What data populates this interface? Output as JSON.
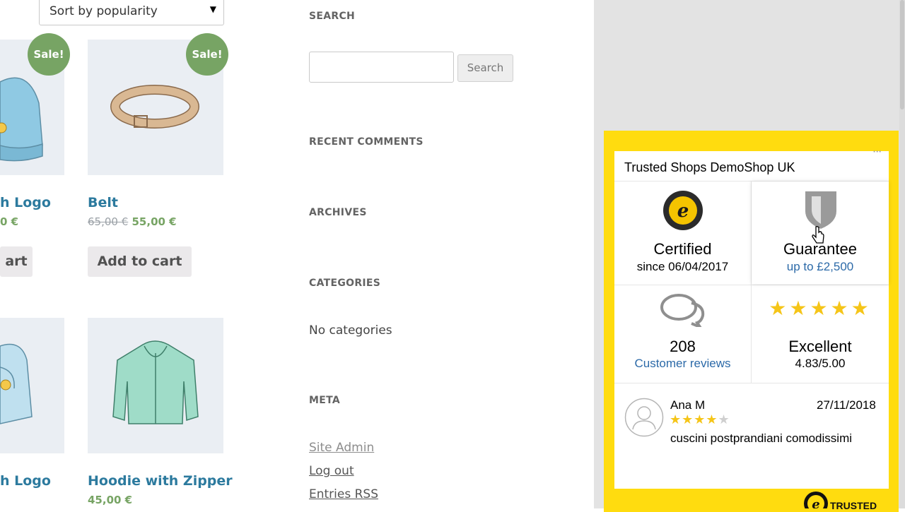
{
  "shop": {
    "sort_select": {
      "value": "Sort by popularity"
    },
    "products": [
      {
        "name": "h Logo",
        "price": "0 €",
        "sale": "Sale!",
        "cart": "art"
      },
      {
        "name": "Belt",
        "old_price": "65,00 €",
        "price": "55,00 €",
        "sale": "Sale!",
        "cart": "Add to cart"
      },
      {
        "name": "h Logo"
      },
      {
        "name": "Hoodie with Zipper",
        "price": "45,00 €"
      }
    ]
  },
  "sidebar": {
    "search_title": "SEARCH",
    "search_placeholder": "",
    "search_button": "Search",
    "recent_comments_title": "RECENT COMMENTS",
    "archives_title": "ARCHIVES",
    "categories_title": "CATEGORIES",
    "no_categories": "No categories",
    "meta_title": "META",
    "meta_links": [
      "Site Admin",
      "Log out",
      "Entries RSS"
    ]
  },
  "trustbadge": {
    "shop_name": "Trusted Shops DemoShop UK",
    "menu_dots": "···",
    "certified_title": "Certified",
    "certified_since": "since 06/04/2017",
    "guarantee_title": "Guarantee",
    "guarantee_amount": "up to £2,500",
    "reviews_count": "208",
    "reviews_label": "Customer reviews",
    "rating_label": "Excellent",
    "rating_value": "4.83/5.00",
    "rating_stars": "★★★★★",
    "review": {
      "author": "Ana M",
      "date": "27/11/2018",
      "stars": "★★★★",
      "star_empty": "★",
      "text": "cuscini postprandiani comodissimi"
    },
    "footer_text": "TRUSTED",
    "colors": {
      "yellow": "#ffdc0f",
      "star": "#f5c518",
      "link": "#2c6aa8",
      "sale_green": "#77a464"
    }
  }
}
